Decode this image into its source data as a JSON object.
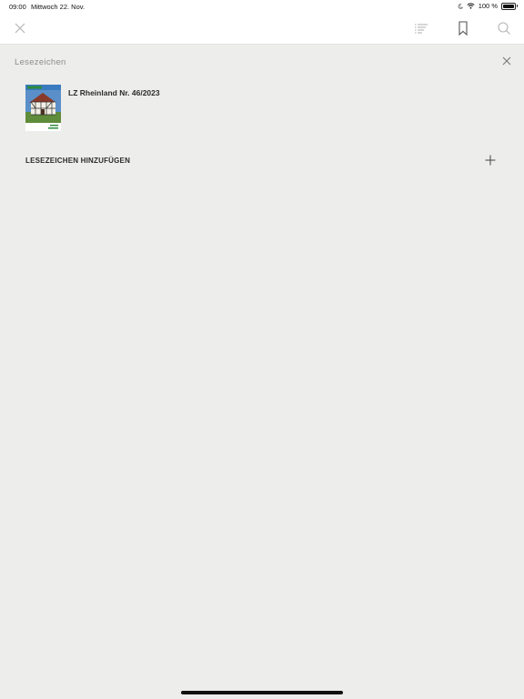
{
  "status_bar": {
    "time": "09:00",
    "date": "Mittwoch 22. Nov.",
    "battery_text": "100 %",
    "battery_level": 1.0
  },
  "toolbar": {
    "icons": [
      "close-icon",
      "list-icon",
      "bookmark-icon",
      "search-icon"
    ]
  },
  "panel": {
    "title": "Lesezeichen",
    "bookmarks": [
      {
        "title": "LZ Rheinland Nr. 46/2023"
      }
    ],
    "add_label": "LESEZEICHEN HINZUFÜGEN"
  },
  "colors": {
    "background": "#ededeb",
    "toolbar": "#ffffff",
    "accent_green": "#2e8b3c"
  }
}
